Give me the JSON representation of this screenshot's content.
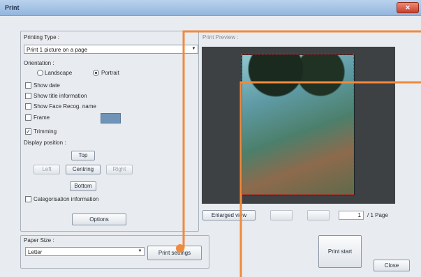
{
  "window": {
    "title": "Print",
    "close_glyph": "✕"
  },
  "printing_type": {
    "label": "Printing Type :",
    "selected": "Print 1 picture on a page",
    "arrow": "▼"
  },
  "orientation": {
    "label": "Orientation :",
    "landscape": "Landscape",
    "portrait": "Portrait"
  },
  "options": {
    "show_date": "Show date",
    "show_title": "Show title information",
    "show_face": "Show Face Recog. name",
    "frame": "Frame",
    "trimming": "Trimming",
    "trimming_check": "✓"
  },
  "display_position": {
    "label": "Display position :",
    "top": "Top",
    "left": "Left",
    "centring": "Centring",
    "right": "Right",
    "bottom": "Bottom"
  },
  "categorisation": "Categorisation information",
  "options_button": "Options",
  "preview": {
    "label": "Print Preview :",
    "enlarged": "Enlarged view",
    "page_value": "1",
    "page_total": "/ 1 Page"
  },
  "paper": {
    "label": "Paper Size :",
    "selected": "Letter",
    "arrow": "▼"
  },
  "buttons": {
    "print_settings": "Print settings",
    "print_start": "Print start",
    "close": "Close"
  },
  "colors": {
    "callout": "#f08a3c",
    "frame_swatch": "#6f94b7"
  }
}
